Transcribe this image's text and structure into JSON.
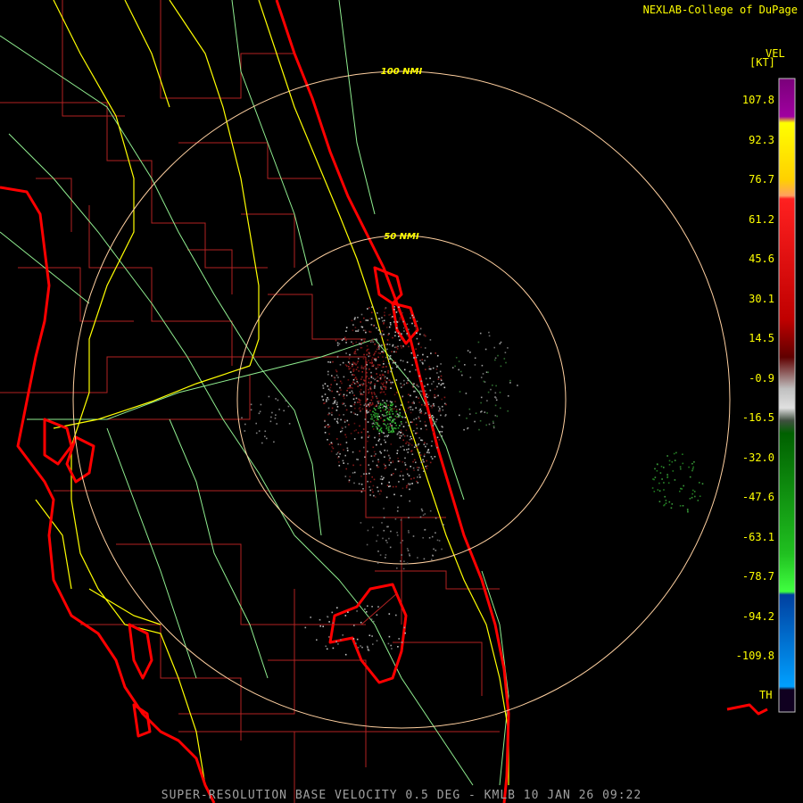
{
  "credit": "NEXLAB-College of DuPage",
  "product_footer": "SUPER-RESOLUTION BASE VELOCITY 0.5 DEG - KMLB 10 JAN 26 09:22",
  "range_rings": {
    "inner_label": "50 NMI",
    "outer_label": "100 NMI"
  },
  "legend": {
    "title": "VEL",
    "unit": "[KT]",
    "ticks": [
      "107.8",
      "92.3",
      "76.7",
      "61.2",
      "45.6",
      "30.1",
      "14.5",
      "-0.9",
      "-16.5",
      "-32.0",
      "-47.6",
      "-63.1",
      "-78.7",
      "-94.2",
      "-109.8"
    ],
    "th_label": "TH"
  },
  "colors": {
    "coast": "#ff0000",
    "county_lines": "#b22222",
    "highways": "#ffff00",
    "roads": "#90ee90",
    "range_ring": "#ffd0a0",
    "text": "#ffff00"
  }
}
